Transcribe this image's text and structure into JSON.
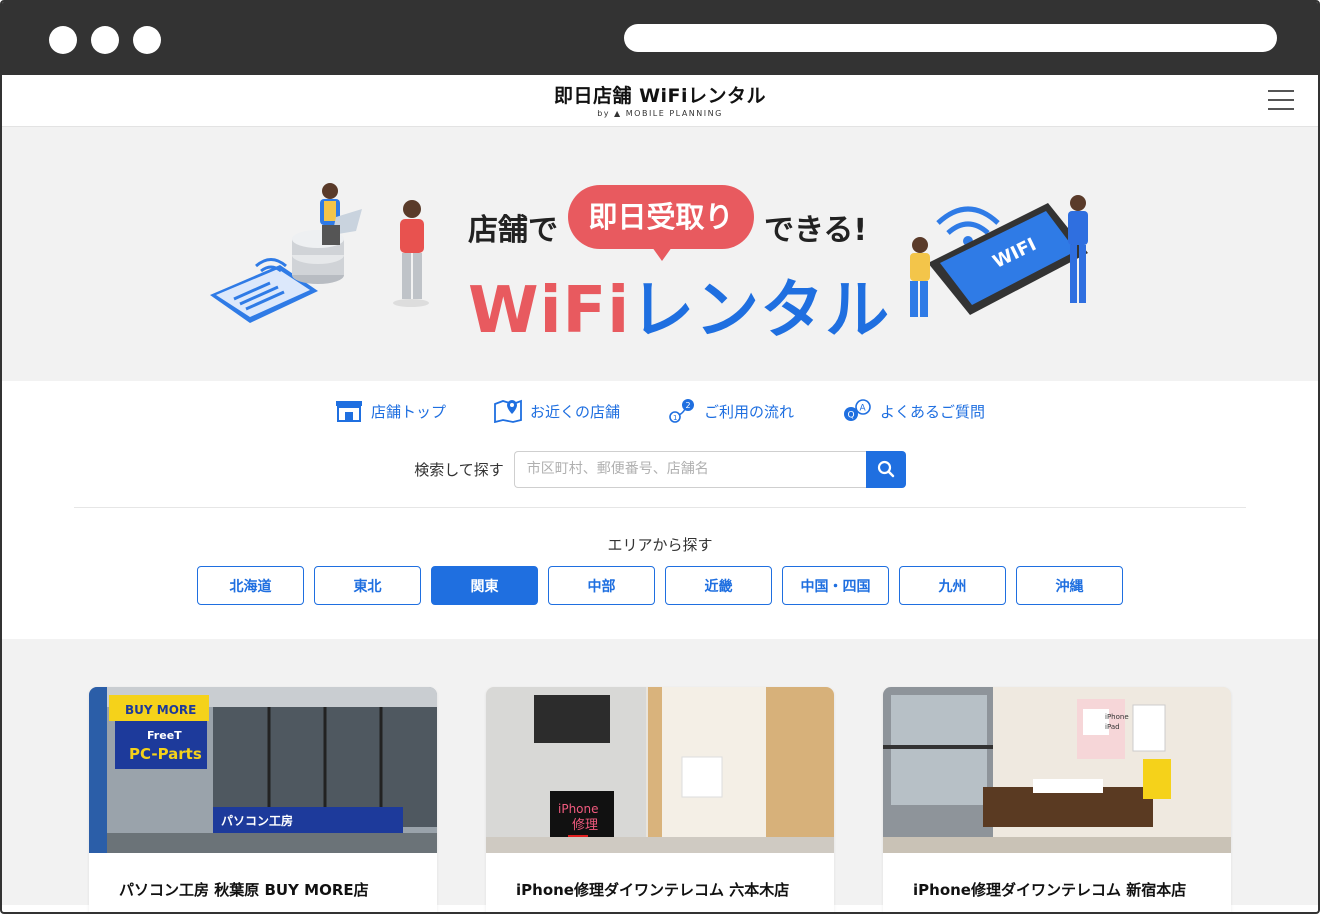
{
  "header": {
    "logo_main": "即日店舗 WiFiレンタル",
    "logo_by": "by",
    "logo_company": "MOBILE PLANNING"
  },
  "hero": {
    "line1_left": "店舗で",
    "line1_pill": "即日受取り",
    "line1_right": "できる!",
    "line2_wifi": "WiFi",
    "line2_rental": "レンタル",
    "tablet_label": "WIFI"
  },
  "nav": {
    "items": [
      {
        "label": "店舗トップ",
        "icon": "store-icon"
      },
      {
        "label": "お近くの店舗",
        "icon": "map-pin-icon"
      },
      {
        "label": "ご利用の流れ",
        "icon": "flow-steps-icon"
      },
      {
        "label": "よくあるご質問",
        "icon": "faq-icon"
      }
    ]
  },
  "search": {
    "label": "検索して探す",
    "placeholder": "市区町村、郵便番号、店舗名",
    "value": ""
  },
  "area": {
    "title": "エリアから探す",
    "buttons": [
      "北海道",
      "東北",
      "関東",
      "中部",
      "近畿",
      "中国・四国",
      "九州",
      "沖縄"
    ],
    "selected": "関東"
  },
  "stores": [
    {
      "title": "パソコン工房 秋葉原 BUY MORE店",
      "sign1": "BUY MORE",
      "sign2": "FreeT",
      "sign3": "PC-Parts",
      "sign4": "パソコン工房"
    },
    {
      "title": "iPhone修理ダイワンテレコム 六本木店",
      "sign1": "iPhone",
      "sign2": "修理"
    },
    {
      "title": "iPhone修理ダイワンテレコム 新宿本店",
      "sign1": "iPhone",
      "sign2": "iPad"
    }
  ],
  "colors": {
    "accent_blue": "#1f6fe0",
    "accent_red": "#e85a5f",
    "hero_bg": "#f2f2f2"
  }
}
